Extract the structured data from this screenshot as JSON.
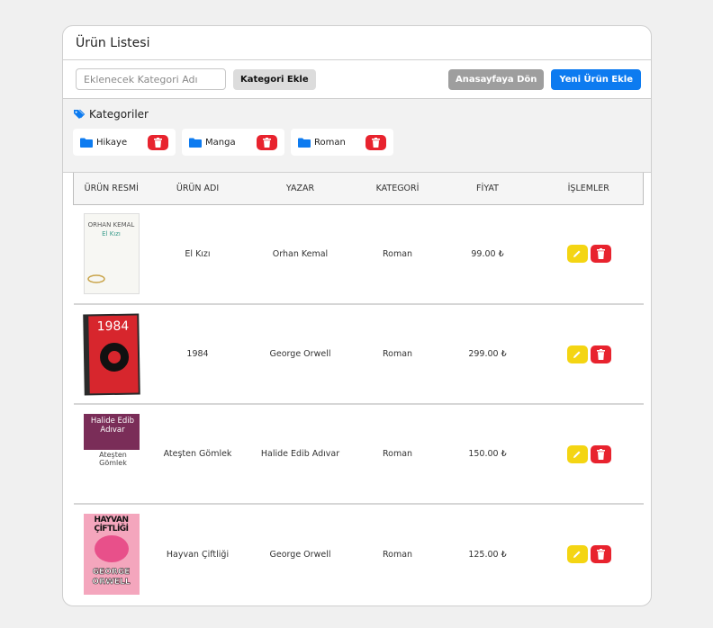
{
  "card": {
    "title": "Ürün Listesi"
  },
  "toolbar": {
    "category_input_placeholder": "Eklenecek Kategori Adı",
    "add_category_label": "Kategori Ekle",
    "home_label": "Anasayfaya Dön",
    "new_product_label": "Yeni Ürün Ekle"
  },
  "categories": {
    "heading": "Kategoriler",
    "items": [
      {
        "label": "Hikaye"
      },
      {
        "label": "Manga"
      },
      {
        "label": "Roman"
      }
    ]
  },
  "table": {
    "headers": [
      "ÜRÜN RESMİ",
      "ÜRÜN ADI",
      "YAZAR",
      "KATEGORİ",
      "FİYAT",
      "İŞLEMLER"
    ],
    "rows": [
      {
        "name": "El Kızı",
        "author": "Orhan Kemal",
        "category": "Roman",
        "price": "99.00 ₺",
        "cover": {
          "line1": "ORHAN KEMAL",
          "line2": "El Kızı"
        }
      },
      {
        "name": "1984",
        "author": "George Orwell",
        "category": "Roman",
        "price": "299.00 ₺",
        "cover": {
          "line1": "1984"
        }
      },
      {
        "name": "Ateşten Gömlek",
        "author": "Halide Edib Adıvar",
        "category": "Roman",
        "price": "150.00 ₺",
        "cover": {
          "line1": "Halide Edib Adıvar",
          "line2": "Ateşten Gömlek"
        }
      },
      {
        "name": "Hayvan Çiftliği",
        "author": "George Orwell",
        "category": "Roman",
        "price": "125.00 ₺",
        "cover": {
          "line1": "HAYVAN ÇİFTLİĞİ",
          "line2": "GEORGE ORWELL"
        }
      }
    ]
  },
  "colors": {
    "primary": "#0d7bf0",
    "danger": "#e8232e",
    "warning": "#f4d513",
    "secondary": "#9e9e9e"
  },
  "icons": {
    "category_heading": "tag-icon",
    "category_item": "folder-icon",
    "edit": "pencil-icon",
    "delete": "trash-icon"
  }
}
